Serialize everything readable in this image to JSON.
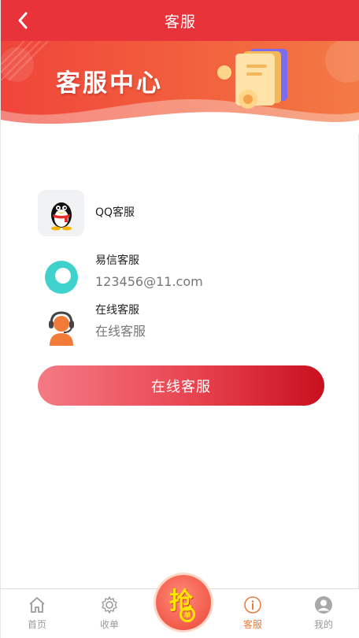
{
  "header": {
    "title": "客服",
    "back_icon": "chevron-left-icon"
  },
  "banner": {
    "title": "客服中心"
  },
  "contacts": [
    {
      "name": "QQ客服",
      "value": "",
      "icon": "qq-penguin-icon"
    },
    {
      "name": "易信客服",
      "value": "123456@11.com",
      "icon": "yixin-chat-icon"
    },
    {
      "name": "在线客服",
      "value": "在线客服",
      "icon": "headset-agent-icon"
    }
  ],
  "cta": {
    "label": "在线客服"
  },
  "tabbar": {
    "items": [
      {
        "label": "首页",
        "icon": "home-icon",
        "active": false
      },
      {
        "label": "收单",
        "icon": "gear-icon",
        "active": false
      },
      {
        "label": "客服",
        "icon": "info-icon",
        "active": true
      },
      {
        "label": "我的",
        "icon": "user-icon",
        "active": false
      }
    ],
    "grab": {
      "label": "抢",
      "sub_label": "单"
    }
  },
  "colors": {
    "primary": "#e8333b",
    "active_tab": "#f07a3a",
    "grab_yellow": "#ffe600"
  }
}
